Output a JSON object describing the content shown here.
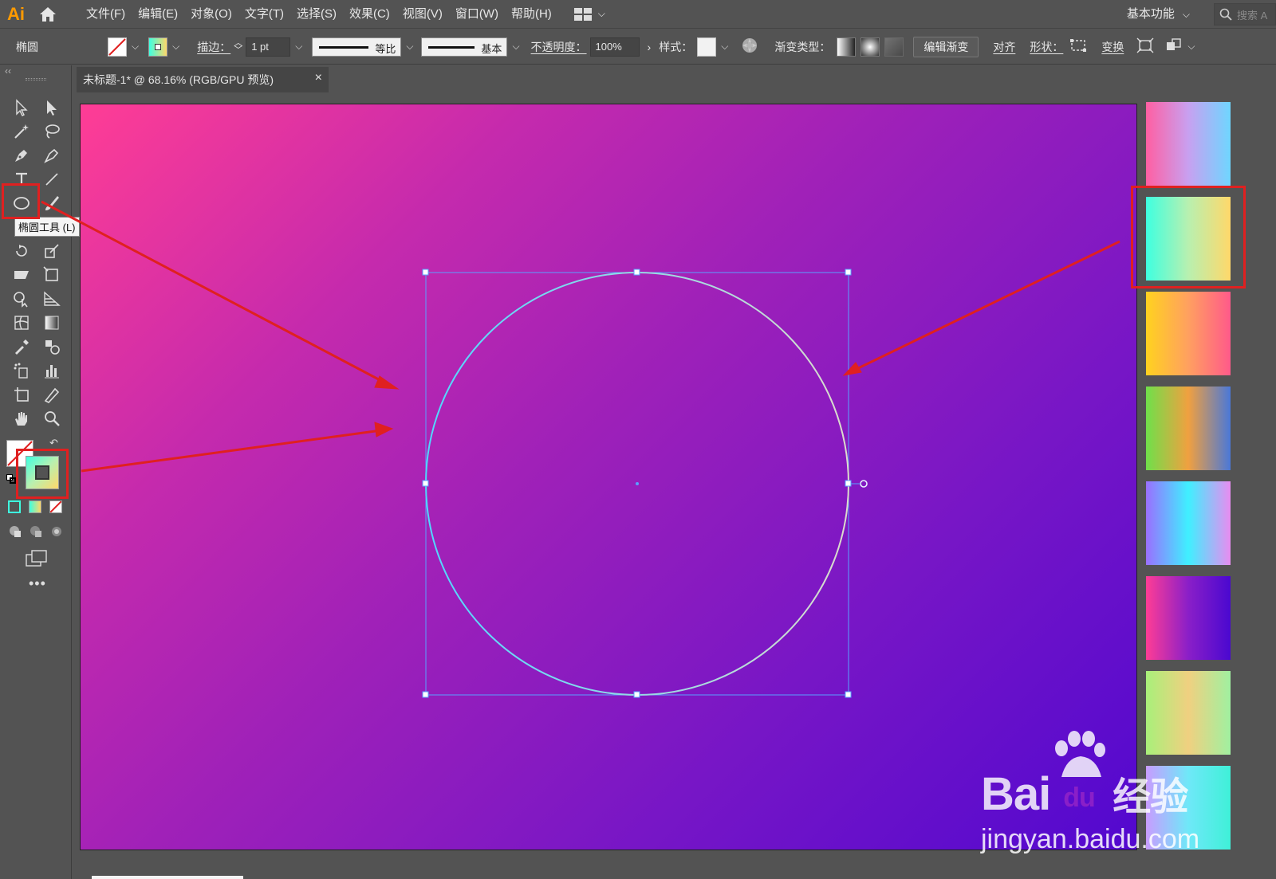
{
  "app": {
    "logo": "Ai"
  },
  "menu": [
    "文件(F)",
    "编辑(E)",
    "对象(O)",
    "文字(T)",
    "选择(S)",
    "效果(C)",
    "视图(V)",
    "窗口(W)",
    "帮助(H)"
  ],
  "workspace": {
    "label": "基本功能"
  },
  "search": {
    "placeholder": "搜索 A"
  },
  "control": {
    "object_type": "椭圆",
    "stroke_label": "描边：",
    "stroke_weight": "1 pt",
    "profile_1": "等比",
    "profile_2": "基本",
    "opacity_label": "不透明度：",
    "opacity_value": "100%",
    "style_label": "样式：",
    "gradient_type_label": "渐变类型：",
    "edit_gradient": "编辑渐变",
    "align": "对齐",
    "shape": "形状：",
    "transform": "变换"
  },
  "tooltip": "椭圆工具 (L)",
  "document": {
    "tab": "未标题-1* @ 68.16% (RGB/GPU 预览)",
    "close": "×"
  },
  "artboard": {
    "gradient_colors": [
      "#ff3d95",
      "#c52aad",
      "#7716c6",
      "#5208cf"
    ]
  },
  "colors": {
    "accent_red": "#e02020",
    "selection_blue": "#5aa0ff"
  },
  "swatches": [
    {
      "name": "pink-lavender-cyan",
      "colors": [
        "#ff5fa2",
        "#c8a0f0",
        "#6fd6ff"
      ]
    },
    {
      "name": "cyan-yellow",
      "colors": [
        "#3effe0",
        "#b8f0b0",
        "#ffd86a"
      ]
    },
    {
      "name": "yellow-pink",
      "colors": [
        "#ffd21f",
        "#ffa060",
        "#ff5a8a"
      ]
    },
    {
      "name": "green-orange-blue",
      "colors": [
        "#6fe04a",
        "#f0a040",
        "#4a78d8"
      ]
    },
    {
      "name": "purple-cyan-pink",
      "colors": [
        "#9a6fff",
        "#3ff0ff",
        "#e88cf0"
      ]
    },
    {
      "name": "magenta-violet",
      "colors": [
        "#ff3d95",
        "#8a1fc8",
        "#4a08d0"
      ]
    },
    {
      "name": "green-peach",
      "colors": [
        "#a8f07a",
        "#f0d080",
        "#a0f0a0"
      ]
    },
    {
      "name": "lilac-cyan",
      "colors": [
        "#c89cff",
        "#6fe8f8",
        "#3ff0d8"
      ]
    }
  ],
  "watermark": {
    "brand": "Bai",
    "brand_du": "du",
    "cn": "经验",
    "url": "jingyan.baidu.com"
  }
}
